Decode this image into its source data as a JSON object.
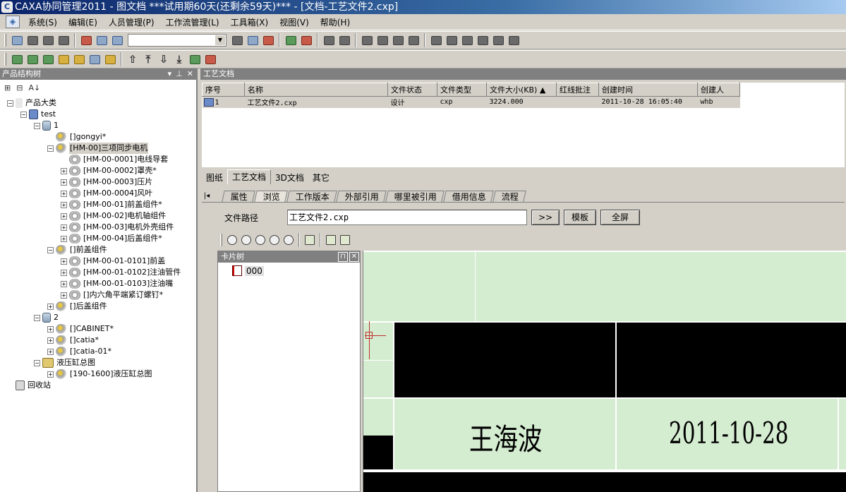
{
  "window": {
    "title": "CAXA协同管理2011 - 图文档   ***试用期60天(还剩余59天)*** - [文档-工艺文件2.cxp]"
  },
  "menu": {
    "items": [
      "系统(S)",
      "编辑(E)",
      "人员管理(P)",
      "工作流管理(L)",
      "工具箱(X)",
      "视图(V)",
      "帮助(H)"
    ]
  },
  "left_panel": {
    "title": "产品结构树",
    "tree": [
      {
        "label": "产品大类",
        "level": 0,
        "exp": "-",
        "icon": "star"
      },
      {
        "label": "test",
        "level": 1,
        "exp": "-",
        "icon": "net"
      },
      {
        "label": "1",
        "level": 2,
        "exp": "-",
        "icon": "db"
      },
      {
        "label": "[]gongyi*",
        "level": 3,
        "exp": "",
        "icon": "gears"
      },
      {
        "label": "[HM-00]三项同步电机",
        "level": 3,
        "exp": "-",
        "icon": "gears",
        "selected": true
      },
      {
        "label": "[HM-00-0001]电线导套",
        "level": 4,
        "exp": "",
        "icon": "gear"
      },
      {
        "label": "[HM-00-0002]罩壳*",
        "level": 4,
        "exp": "+",
        "icon": "gear"
      },
      {
        "label": "[HM-00-0003]压片",
        "level": 4,
        "exp": "+",
        "icon": "gear"
      },
      {
        "label": "[HM-00-0004]风叶",
        "level": 4,
        "exp": "+",
        "icon": "gear"
      },
      {
        "label": "[HM-00-01]前盖组件*",
        "level": 4,
        "exp": "+",
        "icon": "gear"
      },
      {
        "label": "[HM-00-02]电机轴组件",
        "level": 4,
        "exp": "+",
        "icon": "gear"
      },
      {
        "label": "[HM-00-03]电机外壳组件",
        "level": 4,
        "exp": "+",
        "icon": "gear"
      },
      {
        "label": "[HM-00-04]后盖组件*",
        "level": 4,
        "exp": "+",
        "icon": "gear"
      },
      {
        "label": "[]前盖组件",
        "level": 3,
        "exp": "-",
        "icon": "gears"
      },
      {
        "label": "[HM-00-01-0101]前盖",
        "level": 4,
        "exp": "+",
        "icon": "gear"
      },
      {
        "label": "[HM-00-01-0102]注油管件",
        "level": 4,
        "exp": "+",
        "icon": "gear"
      },
      {
        "label": "[HM-00-01-0103]注油嘴",
        "level": 4,
        "exp": "+",
        "icon": "gear"
      },
      {
        "label": "[]内六角平端紧订螺钉*",
        "level": 4,
        "exp": "+",
        "icon": "gear"
      },
      {
        "label": "[]后盖组件",
        "level": 3,
        "exp": "+",
        "icon": "gears"
      },
      {
        "label": "2",
        "level": 2,
        "exp": "-",
        "icon": "db"
      },
      {
        "label": "[]CABINET*",
        "level": 3,
        "exp": "+",
        "icon": "gears"
      },
      {
        "label": "[]catia*",
        "level": 3,
        "exp": "+",
        "icon": "gears"
      },
      {
        "label": "[]catia-01*",
        "level": 3,
        "exp": "+",
        "icon": "gears"
      },
      {
        "label": "液压缸总图",
        "level": 2,
        "exp": "-",
        "icon": "folder"
      },
      {
        "label": "[190-1600]液压缸总图",
        "level": 3,
        "exp": "+",
        "icon": "gears"
      },
      {
        "label": "回收站",
        "level": 0,
        "exp": "",
        "icon": "trash"
      }
    ]
  },
  "docs_panel": {
    "title": "工艺文档",
    "columns": [
      "序号",
      "名称",
      "文件状态",
      "文件类型",
      "文件大小(KB)",
      "红线批注",
      "创建时间",
      "创建人"
    ],
    "sort_marker": "▲",
    "rows": [
      [
        "1",
        "工艺文件2.cxp",
        "设计",
        "cxp",
        "3224.000",
        "",
        "2011-10-28 16:05:40",
        "whb"
      ]
    ]
  },
  "doc_tabs": [
    "图纸",
    "工艺文档",
    "3D文档",
    "其它"
  ],
  "detail_tabs": [
    "属性",
    "浏览",
    "工作版本",
    "外部引用",
    "哪里被引用",
    "借用信息",
    "流程"
  ],
  "path_row": {
    "label": "文件路径",
    "value": "工艺文件2.cxp",
    "go_button": ">>",
    "template_button": "模板",
    "fullscreen_button": "全屏"
  },
  "card_tree": {
    "title": "卡片树",
    "pin_glyph": "⊓",
    "close_glyph": "✕",
    "node": "000"
  },
  "drawing": {
    "name": "王海波",
    "date": "2011-10-28"
  },
  "colors": {
    "title_bar": "#0a246a",
    "panel_header": "#808080",
    "canvas_bg": "#d4ecd0",
    "cell_fill": "#000000"
  }
}
